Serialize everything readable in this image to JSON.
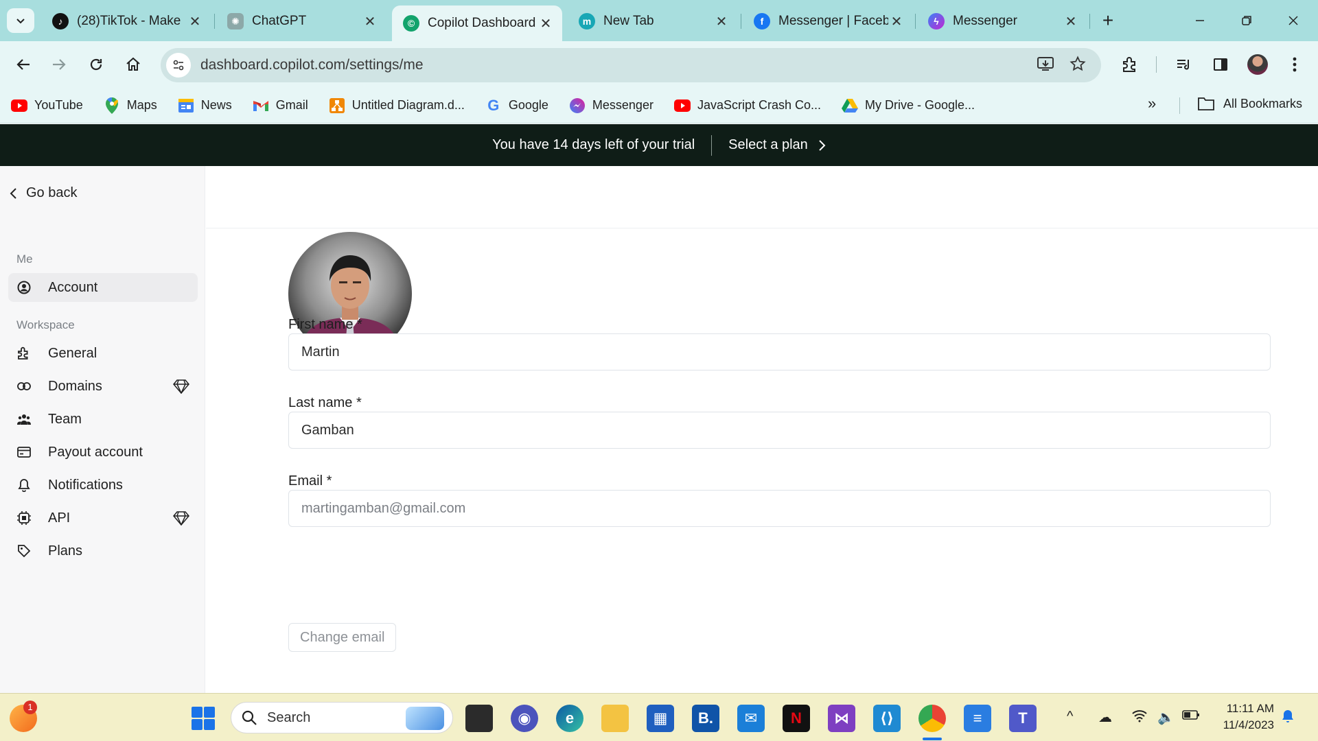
{
  "browser": {
    "tabs": [
      {
        "title": "(28)TikTok - Make",
        "favicon": "tiktok-icon"
      },
      {
        "title": "ChatGPT",
        "favicon": "chatgpt-icon"
      },
      {
        "title": "Copilot Dashboard",
        "favicon": "copilot-icon",
        "active": true
      },
      {
        "title": "New Tab",
        "favicon": "m-icon"
      },
      {
        "title": "Messenger | Faceb",
        "favicon": "facebook-icon"
      },
      {
        "title": "Messenger",
        "favicon": "messenger-icon"
      }
    ],
    "url": "dashboard.copilot.com/settings/me",
    "bookmarks": [
      {
        "label": "YouTube",
        "icon": "youtube-icon"
      },
      {
        "label": "Maps",
        "icon": "maps-icon"
      },
      {
        "label": "News",
        "icon": "news-icon"
      },
      {
        "label": "Gmail",
        "icon": "gmail-icon"
      },
      {
        "label": "Untitled Diagram.d...",
        "icon": "diagram-icon"
      },
      {
        "label": "Google",
        "icon": "google-icon"
      },
      {
        "label": "Messenger",
        "icon": "messenger-icon"
      },
      {
        "label": "JavaScript Crash Co...",
        "icon": "youtube-icon"
      },
      {
        "label": "My Drive - Google...",
        "icon": "drive-icon"
      }
    ],
    "all_bookmarks": "All Bookmarks"
  },
  "banner": {
    "trial_text": "You have 14 days left of your trial",
    "cta": "Select a plan"
  },
  "sidebar": {
    "go_back": "Go back",
    "section_me": "Me",
    "section_workspace": "Workspace",
    "items": [
      {
        "label": "Account",
        "icon": "user-circle-icon",
        "active": true
      },
      {
        "label": "General",
        "icon": "puzzle-icon"
      },
      {
        "label": "Domains",
        "icon": "link-icon",
        "premium": true
      },
      {
        "label": "Team",
        "icon": "team-icon"
      },
      {
        "label": "Payout account",
        "icon": "card-icon"
      },
      {
        "label": "Notifications",
        "icon": "bell-icon"
      },
      {
        "label": "API",
        "icon": "chip-icon",
        "premium": true
      },
      {
        "label": "Plans",
        "icon": "tag-icon"
      }
    ]
  },
  "form": {
    "first_name_label": "First name *",
    "first_name_value": "Martin",
    "last_name_label": "Last name *",
    "last_name_value": "Gamban",
    "email_label": "Email *",
    "email_value": "martingamban@gmail.com",
    "change_email": "Change email"
  },
  "taskbar": {
    "search_placeholder": "Search",
    "notification_count": "1",
    "time": "11:11 AM",
    "date": "11/4/2023"
  },
  "colors": {
    "tabstrip": "#a8dede",
    "banner": "#0f1d17",
    "taskbar": "#f3f0c9"
  }
}
